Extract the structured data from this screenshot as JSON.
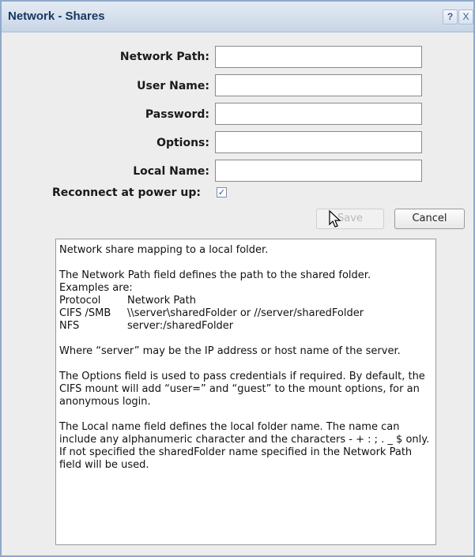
{
  "window": {
    "title": "Network - Shares",
    "help_label": "?",
    "close_label": "X"
  },
  "form": {
    "network_path": {
      "label": "Network Path:",
      "value": "",
      "placeholder": ""
    },
    "user_name": {
      "label": "User Name:",
      "value": "",
      "placeholder": ""
    },
    "password": {
      "label": "Password:",
      "value": "",
      "placeholder": ""
    },
    "options": {
      "label": "Options:",
      "value": "",
      "placeholder": ""
    },
    "local_name": {
      "label": "Local Name:",
      "value": "",
      "placeholder": ""
    },
    "reconnect": {
      "label": "Reconnect at power up:",
      "checked": true,
      "check_glyph": "✓"
    }
  },
  "buttons": {
    "save": "Save",
    "cancel": "Cancel"
  },
  "help": {
    "intro": "Network share mapping to a local folder.",
    "path_desc": "The Network Path field defines the path to the shared folder.",
    "examples_heading": "Examples are:",
    "examples": [
      {
        "protocol": "Protocol",
        "path": "Network Path"
      },
      {
        "protocol": "CIFS /SMB",
        "path": "\\\\server\\sharedFolder or //server/sharedFolder"
      },
      {
        "protocol": "NFS",
        "path": "server:/sharedFolder"
      }
    ],
    "server_note": "Where “server” may be the IP address or host name of the server.",
    "options_note": "The Options field is used to pass credentials if required.  By default, the CIFS mount will add “user=” and “guest” to the mount options, for an anonymous login.",
    "local_note": "The Local name field defines the local folder name. The name can include any alphanumeric character and the characters - + : ; . _ $  only. If not specified the sharedFolder name specified in the Network Path field will be used."
  }
}
